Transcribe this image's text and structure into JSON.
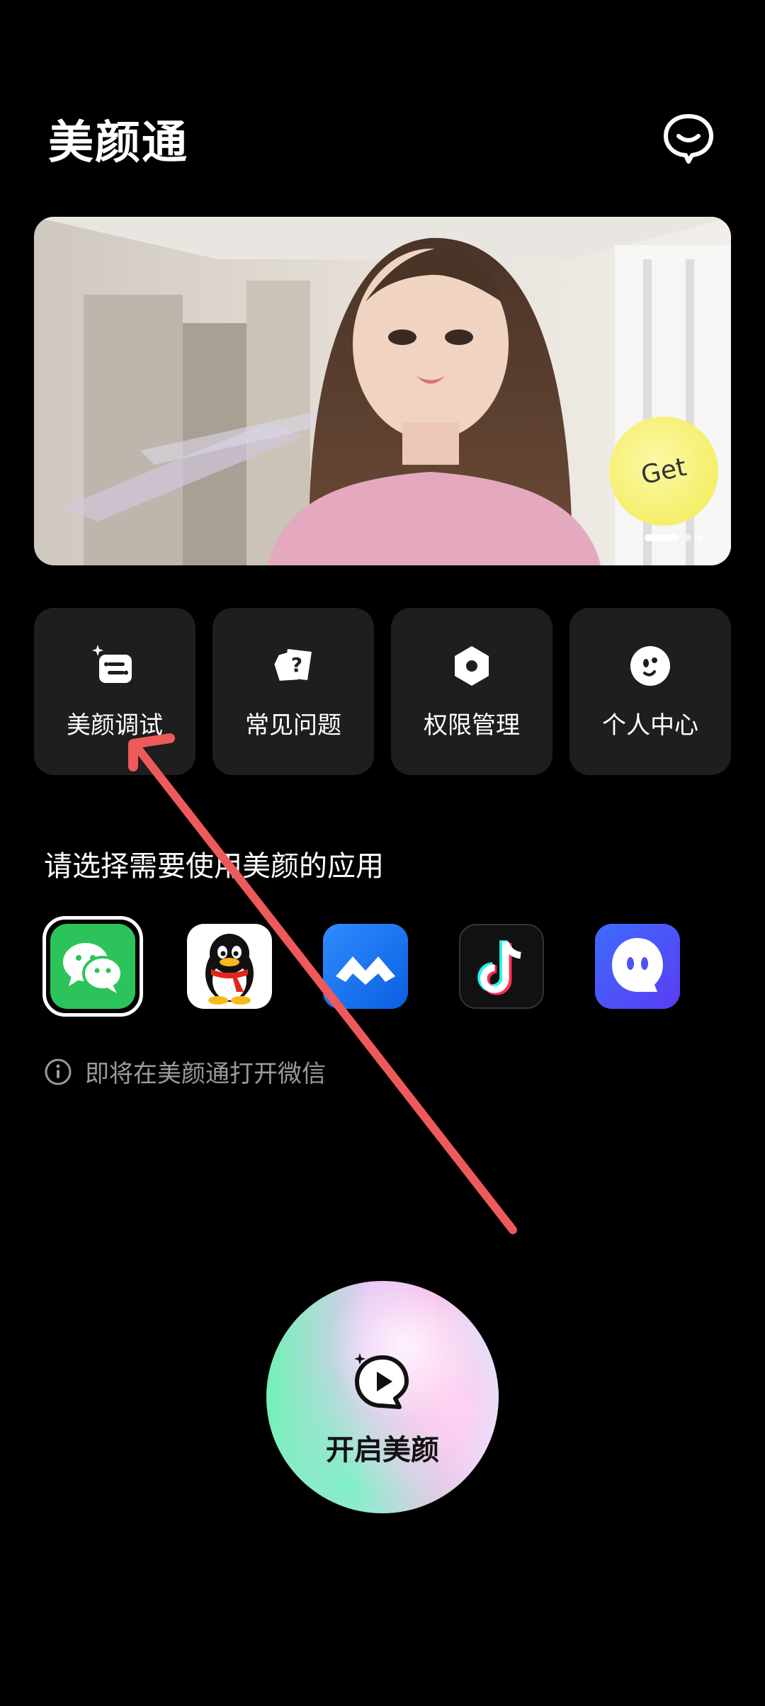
{
  "header": {
    "title": "美颜通",
    "chat_icon": "chat-bubble-icon"
  },
  "banner": {
    "badge_text": "Get",
    "slide_count": 3,
    "active_slide": 1
  },
  "tiles": [
    {
      "label": "美颜调试",
      "icon": "beauty-adjust-icon"
    },
    {
      "label": "常见问题",
      "icon": "faq-icon"
    },
    {
      "label": "权限管理",
      "icon": "permission-icon"
    },
    {
      "label": "个人中心",
      "icon": "profile-icon"
    }
  ],
  "apps_section": {
    "title": "请选择需要使用美颜的应用",
    "apps": [
      {
        "name": "wechat",
        "selected": true
      },
      {
        "name": "qq",
        "selected": false
      },
      {
        "name": "tencent-meeting",
        "selected": false
      },
      {
        "name": "douyin",
        "selected": false
      },
      {
        "name": "app-five",
        "selected": false
      }
    ],
    "hint": "即将在美颜通打开微信"
  },
  "start_button": {
    "label": "开启美颜"
  },
  "colors": {
    "background": "#000000",
    "tile_bg": "#1e1e1e",
    "wechat_green": "#2dc35b",
    "arrow_red": "#ee5a5a",
    "badge_yellow": "#f5ef6c"
  }
}
